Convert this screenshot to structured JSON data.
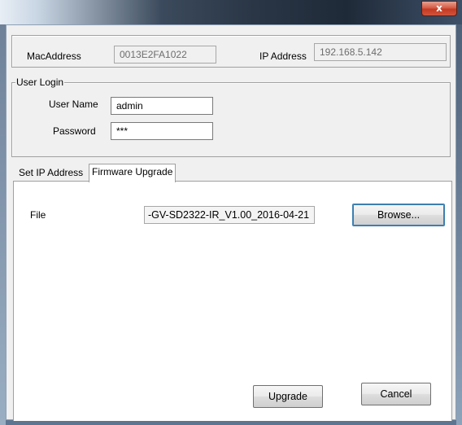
{
  "window": {
    "close_label": "x"
  },
  "device_info": {
    "mac_label": "MacAddress",
    "mac_value": "0013E2FA1022",
    "ip_label": "IP Address",
    "ip_value": "192.168.5.142"
  },
  "user_login": {
    "group_label": "User Login",
    "username_label": "User Name",
    "username_value": "admin",
    "password_label": "Password",
    "password_value": "***"
  },
  "tabs": [
    {
      "label": "Set IP Address",
      "active": false
    },
    {
      "label": "Firmware Upgrade",
      "active": true
    }
  ],
  "firmware": {
    "file_label": "File",
    "file_value": "-GV-SD2322-IR_V1.00_2016-04-21",
    "browse_label": "Browse...",
    "upgrade_label": "Upgrade",
    "cancel_label": "Cancel"
  }
}
